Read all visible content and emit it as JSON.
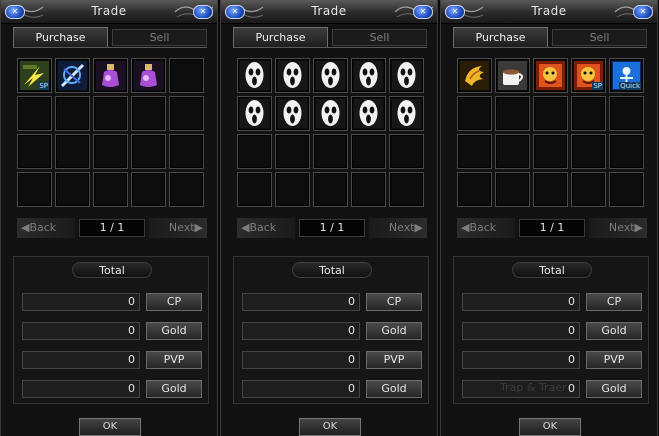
{
  "windows": [
    {
      "title": "Trade",
      "tabs": {
        "purchase": "Purchase",
        "sell": "Sell"
      },
      "items": [
        {
          "icon": "lightning-scroll-icon",
          "badge": "SP"
        },
        {
          "icon": "blue-skill-icon",
          "badge": ""
        },
        {
          "icon": "purple-potion-icon",
          "badge": ""
        },
        {
          "icon": "purple-potion-icon",
          "badge": ""
        },
        {
          "icon": "empty",
          "badge": ""
        }
      ],
      "pager": {
        "back": "Back",
        "page": "1 / 1",
        "next": "Next"
      },
      "total": {
        "label": "Total",
        "rows": [
          {
            "value": "0",
            "currency": "CP"
          },
          {
            "value": "0",
            "currency": "Gold"
          },
          {
            "value": "0",
            "currency": "PVP"
          },
          {
            "value": "0",
            "currency": "Gold"
          }
        ]
      },
      "ok": "OK"
    },
    {
      "title": "Trade",
      "tabs": {
        "purchase": "Purchase",
        "sell": "Sell"
      },
      "items": [
        {
          "icon": "ghost-mask-icon"
        },
        {
          "icon": "ghost-mask-icon"
        },
        {
          "icon": "ghost-mask-icon"
        },
        {
          "icon": "ghost-mask-icon"
        },
        {
          "icon": "ghost-mask-icon"
        },
        {
          "icon": "ghost-mask-icon"
        },
        {
          "icon": "ghost-mask-icon"
        },
        {
          "icon": "ghost-mask-icon"
        },
        {
          "icon": "ghost-mask-icon"
        },
        {
          "icon": "ghost-mask-icon"
        }
      ],
      "pager": {
        "back": "Back",
        "page": "1 / 1",
        "next": "Next"
      },
      "total": {
        "label": "Total",
        "rows": [
          {
            "value": "0",
            "currency": "CP"
          },
          {
            "value": "0",
            "currency": "Gold"
          },
          {
            "value": "0",
            "currency": "PVP"
          },
          {
            "value": "0",
            "currency": "Gold"
          }
        ]
      },
      "ok": "OK"
    },
    {
      "title": "Trade",
      "tabs": {
        "purchase": "Purchase",
        "sell": "Sell"
      },
      "items": [
        {
          "icon": "golden-wing-icon",
          "badge": ""
        },
        {
          "icon": "coffee-cup-icon",
          "badge": ""
        },
        {
          "icon": "monster-card-icon",
          "badge": ""
        },
        {
          "icon": "monster-card-icon",
          "badge": "SP"
        },
        {
          "icon": "quick-skill-icon",
          "badge": "Quick"
        }
      ],
      "pager": {
        "back": "Back",
        "page": "1 / 1",
        "next": "Next"
      },
      "total": {
        "label": "Total",
        "rows": [
          {
            "value": "0",
            "currency": "CP"
          },
          {
            "value": "0",
            "currency": "Gold"
          },
          {
            "value": "0",
            "currency": "PVP"
          },
          {
            "value": "0",
            "currency": "Gold"
          }
        ]
      },
      "ok": "OK"
    }
  ],
  "watermark": "Trap & Traer",
  "colors": {
    "panel_bg": "#121212",
    "slot_border": "#4a4a4a",
    "orb_blue": "#1f4fc0",
    "text_main": "#e6e6e6",
    "text_dim": "#7d7d7d"
  }
}
